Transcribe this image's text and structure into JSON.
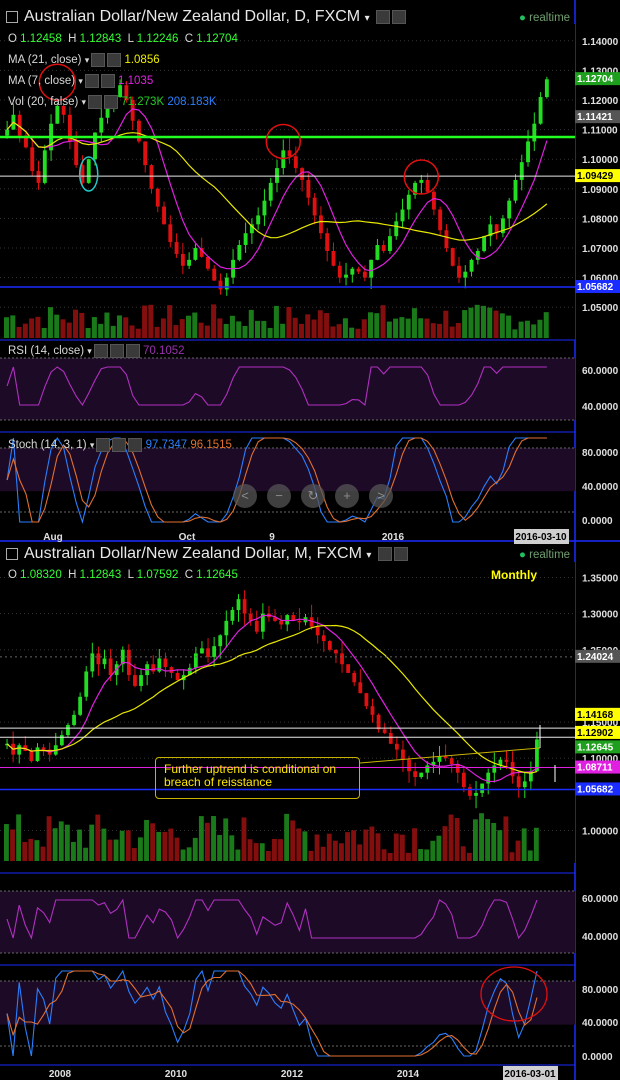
{
  "top": {
    "title": "Australian Dollar/New Zealand Dollar, D, FXCM",
    "realtime": "realtime",
    "ohlc": {
      "o_label": "O",
      "o": "1.12458",
      "h_label": "H",
      "h": "1.12843",
      "l_label": "L",
      "l": "1.12246",
      "c_label": "C",
      "c": "1.12704"
    },
    "ma21": {
      "label": "MA (21, close)",
      "value": "1.0856"
    },
    "ma7": {
      "label": "MA (7, close)",
      "value": "1.1035"
    },
    "vol": {
      "label": "Vol (20, false)",
      "v1": "71.273K",
      "v2": "208.183K"
    },
    "rsi": {
      "label": "RSI (14, close)",
      "value": "70.1052"
    },
    "stoch": {
      "label": "Stoch (14, 3, 1)",
      "k": "97.7347",
      "d": "96.1515"
    },
    "price_ticks": [
      "1.14000",
      "1.13000",
      "1.12000",
      "1.11000",
      "1.10000",
      "1.09000",
      "1.08000",
      "1.07000",
      "1.06000",
      "1.05000"
    ],
    "price_tags": {
      "last": "1.12704",
      "res": "1.11421",
      "sup": "1.09429",
      "low": "1.05682"
    },
    "rsi_ticks": [
      "60.0000",
      "40.0000"
    ],
    "stoch_ticks": [
      "80.0000",
      "40.0000",
      "0.0000"
    ],
    "xlabels": [
      "Aug",
      "Oct",
      "9",
      "2016"
    ],
    "date_tag": "2016-03-10"
  },
  "bottom": {
    "title": "Australian Dollar/New Zealand Dollar, M, FXCM",
    "realtime": "realtime",
    "ohlc": {
      "o_label": "O",
      "o": "1.08320",
      "h_label": "H",
      "h": "1.12843",
      "l_label": "L",
      "l": "1.07592",
      "c_label": "C",
      "c": "1.12645"
    },
    "timeframe": "Monthly",
    "annotation": "Further uptrend is conditional on breach of reisstance",
    "price_ticks": [
      "1.35000",
      "1.30000",
      "1.25000",
      "1.15000",
      "1.10000",
      "1.00000"
    ],
    "price_tags": {
      "t1": "1.24024",
      "t2": "1.14168",
      "t3": "1.12902",
      "last": "1.12645",
      "t5": "1.08711",
      "t6": "1.05682"
    },
    "rsi_ticks": [
      "60.0000",
      "40.0000"
    ],
    "stoch_ticks": [
      "80.0000",
      "40.0000",
      "0.0000"
    ],
    "xlabels": [
      "2008",
      "2010",
      "2012",
      "2014"
    ],
    "date_tag": "2016-03-01"
  },
  "colors": {
    "up": "#22dd22",
    "down": "#e01010",
    "ma_fast": "#e020e0",
    "ma_slow": "#e8e800",
    "rsi": "#b030c0",
    "stoch_k": "#2a7fff",
    "stoch_d": "#e07030",
    "hline_green": "#22ff22",
    "panel_bg": "#1d0a26",
    "axis": "#1a2cff"
  },
  "chart_data": [
    {
      "type": "candlestick",
      "title": "Australian Dollar/New Zealand Dollar, D, FXCM",
      "timeframe": "Daily",
      "ylim": [
        1.045,
        1.145
      ],
      "x_labels": [
        "Aug",
        "Oct",
        "9",
        "2016"
      ],
      "levels": [
        1.1075,
        1.09429,
        1.05682
      ],
      "last": {
        "open": 1.12458,
        "high": 1.12843,
        "low": 1.12246,
        "close": 1.12704
      },
      "ma": [
        {
          "period": 21,
          "value": 1.0856
        },
        {
          "period": 7,
          "value": 1.1035
        }
      ],
      "rsi_last": 70.1052,
      "stoch_last": {
        "k": 97.7347,
        "d": 96.1515
      },
      "closes": [
        1.11,
        1.115,
        1.108,
        1.104,
        1.096,
        1.092,
        1.103,
        1.112,
        1.118,
        1.115,
        1.106,
        1.098,
        1.092,
        1.1,
        1.109,
        1.114,
        1.117,
        1.121,
        1.125,
        1.12,
        1.113,
        1.106,
        1.098,
        1.09,
        1.084,
        1.078,
        1.072,
        1.068,
        1.064,
        1.066,
        1.07,
        1.067,
        1.063,
        1.059,
        1.056,
        1.06,
        1.066,
        1.071,
        1.075,
        1.078,
        1.081,
        1.086,
        1.092,
        1.097,
        1.103,
        1.101,
        1.097,
        1.093,
        1.087,
        1.081,
        1.075,
        1.069,
        1.064,
        1.06,
        1.061,
        1.063,
        1.062,
        1.06,
        1.066,
        1.071,
        1.069,
        1.074,
        1.079,
        1.083,
        1.088,
        1.092,
        1.093,
        1.089,
        1.083,
        1.076,
        1.07,
        1.064,
        1.06,
        1.062,
        1.066,
        1.069,
        1.074,
        1.078,
        1.075,
        1.08,
        1.086,
        1.093,
        1.099,
        1.106,
        1.112,
        1.121,
        1.127
      ]
    },
    {
      "type": "candlestick",
      "title": "Australian Dollar/New Zealand Dollar, M, FXCM",
      "timeframe": "Monthly",
      "ylim": [
        0.98,
        1.37
      ],
      "x_labels": [
        "2008",
        "2010",
        "2012",
        "2014"
      ],
      "levels": [
        1.24024,
        1.14168,
        1.12902,
        1.12645,
        1.08711,
        1.05682
      ],
      "last": {
        "open": 1.0832,
        "high": 1.12843,
        "low": 1.07592,
        "close": 1.12645
      },
      "closes": [
        1.12,
        1.105,
        1.118,
        1.11,
        1.096,
        1.115,
        1.112,
        1.105,
        1.118,
        1.132,
        1.146,
        1.16,
        1.185,
        1.22,
        1.245,
        1.23,
        1.238,
        1.215,
        1.23,
        1.25,
        1.215,
        1.2,
        1.215,
        1.23,
        1.22,
        1.238,
        1.226,
        1.218,
        1.208,
        1.215,
        1.225,
        1.245,
        1.252,
        1.24,
        1.255,
        1.27,
        1.29,
        1.305,
        1.32,
        1.3,
        1.29,
        1.275,
        1.3,
        1.295,
        1.29,
        1.285,
        1.298,
        1.29,
        1.288,
        1.295,
        1.282,
        1.27,
        1.262,
        1.25,
        1.245,
        1.23,
        1.218,
        1.205,
        1.19,
        1.172,
        1.16,
        1.14,
        1.135,
        1.12,
        1.112,
        1.098,
        1.082,
        1.074,
        1.08,
        1.09,
        1.095,
        1.103,
        1.1,
        1.092,
        1.08,
        1.06,
        1.048,
        1.052,
        1.065,
        1.08,
        1.09,
        1.098,
        1.095,
        1.075,
        1.06,
        1.068,
        1.082,
        1.126
      ]
    }
  ]
}
